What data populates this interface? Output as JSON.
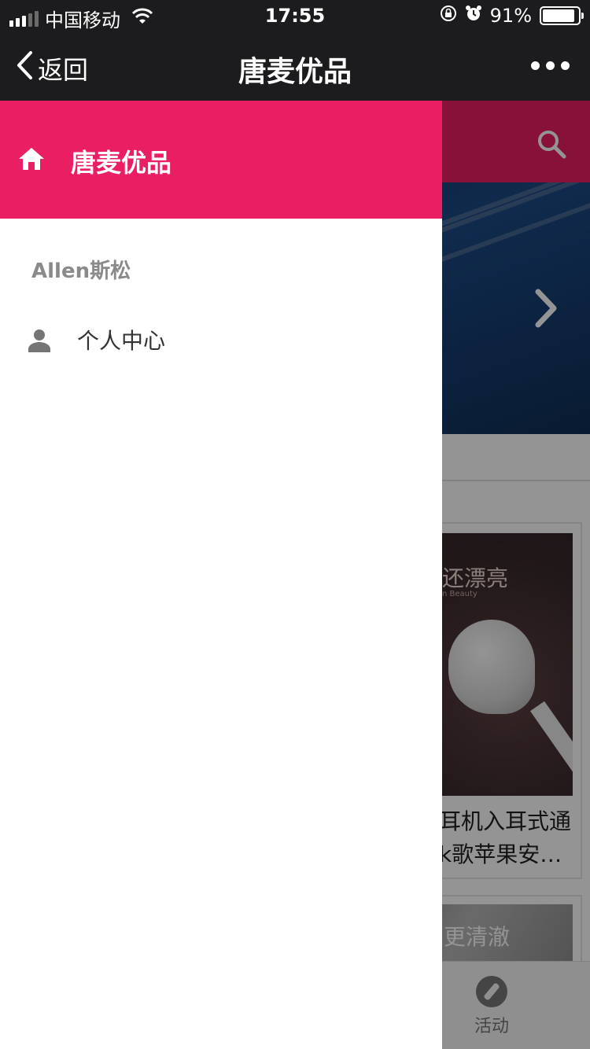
{
  "status_bar": {
    "carrier": "中国移动",
    "time": "17:55",
    "battery_percent": "91%",
    "battery_level": 0.91
  },
  "nav_bar": {
    "back_label": "返回",
    "title": "唐麦优品"
  },
  "drawer": {
    "brand": "唐麦优品",
    "user_name": "Allen斯松",
    "menu_items": [
      {
        "label": "个人中心",
        "icon": "person-icon"
      }
    ]
  },
  "background_page": {
    "product_slogan": "还漂亮",
    "product_sub": "n Beauty",
    "product_name_line1": "耳机入耳式通",
    "product_name_line2": "k歌苹果安…",
    "second_card_slogan": "更清澈",
    "tab_label": "活动"
  },
  "colors": {
    "accent": "#e91e63",
    "status_bar_bg": "#1c1c1e"
  }
}
